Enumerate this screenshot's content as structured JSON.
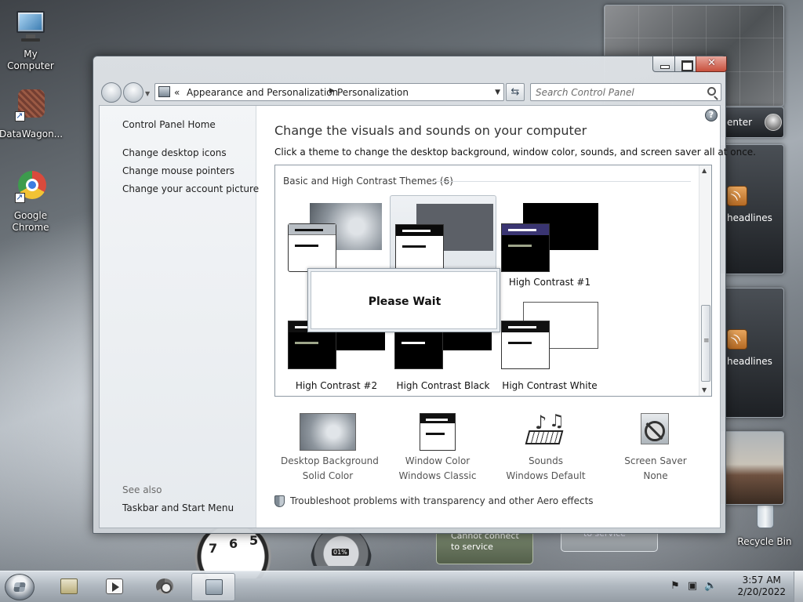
{
  "desktop": {
    "icons": [
      {
        "label": "My Computer"
      },
      {
        "label": "DataWagon..."
      },
      {
        "label": "Google Chrome"
      },
      {
        "label": "Recycle Bin"
      }
    ],
    "gadgets": {
      "media_center_label": "enter",
      "headlines_1": "headlines",
      "headlines_2": "headlines",
      "service_1": "Cannot connect to service",
      "service_2": "to service",
      "meter_percent": "01%",
      "clock_numbers": [
        "7",
        "6",
        "5"
      ]
    }
  },
  "window": {
    "address": {
      "overflow": "«",
      "crumbs": [
        "Appearance and Personalization",
        "Personalization"
      ]
    },
    "search": {
      "placeholder": "Search Control Panel"
    },
    "help_glyph": "?",
    "left_pane": {
      "home": "Control Panel Home",
      "links": [
        "Change desktop icons",
        "Change mouse pointers",
        "Change your account picture"
      ],
      "see_also_label": "See also",
      "see_also_links": [
        "Taskbar and Start Menu"
      ]
    },
    "main": {
      "title": "Change the visuals and sounds on your computer",
      "subtitle": "Click a theme to change the desktop background, window color, sounds, and screen saver all at once.",
      "group_title": "Basic and High Contrast Themes (6)",
      "themes": [
        {
          "label": "",
          "selected": false
        },
        {
          "label": "",
          "selected": true
        },
        {
          "label": "High Contrast #1",
          "selected": false
        },
        {
          "label": "High Contrast #2",
          "selected": false
        },
        {
          "label": "High Contrast Black",
          "selected": false
        },
        {
          "label": "High Contrast White",
          "selected": false
        }
      ],
      "dialog": {
        "text": "Please Wait"
      },
      "options": [
        {
          "title": "Desktop Background",
          "value": "Solid Color",
          "icon": "desktop-background-icon"
        },
        {
          "title": "Window Color",
          "value": "Windows Classic",
          "icon": "window-color-icon"
        },
        {
          "title": "Sounds",
          "value": "Windows Default",
          "icon": "sounds-icon"
        },
        {
          "title": "Screen Saver",
          "value": "None",
          "icon": "screen-saver-icon"
        }
      ],
      "troubleshoot": "Troubleshoot problems with transparency and other Aero effects"
    }
  },
  "taskbar": {
    "buttons": [
      "windows-explorer",
      "media-player",
      "google-chrome",
      "control-panel"
    ],
    "active_index": 3,
    "clock": {
      "time": "3:57 AM",
      "date": "2/20/2022"
    }
  },
  "colors": {
    "window_frame": "#dde1e5",
    "close_button": "#c8503c",
    "selection": "#e4e9ee"
  }
}
